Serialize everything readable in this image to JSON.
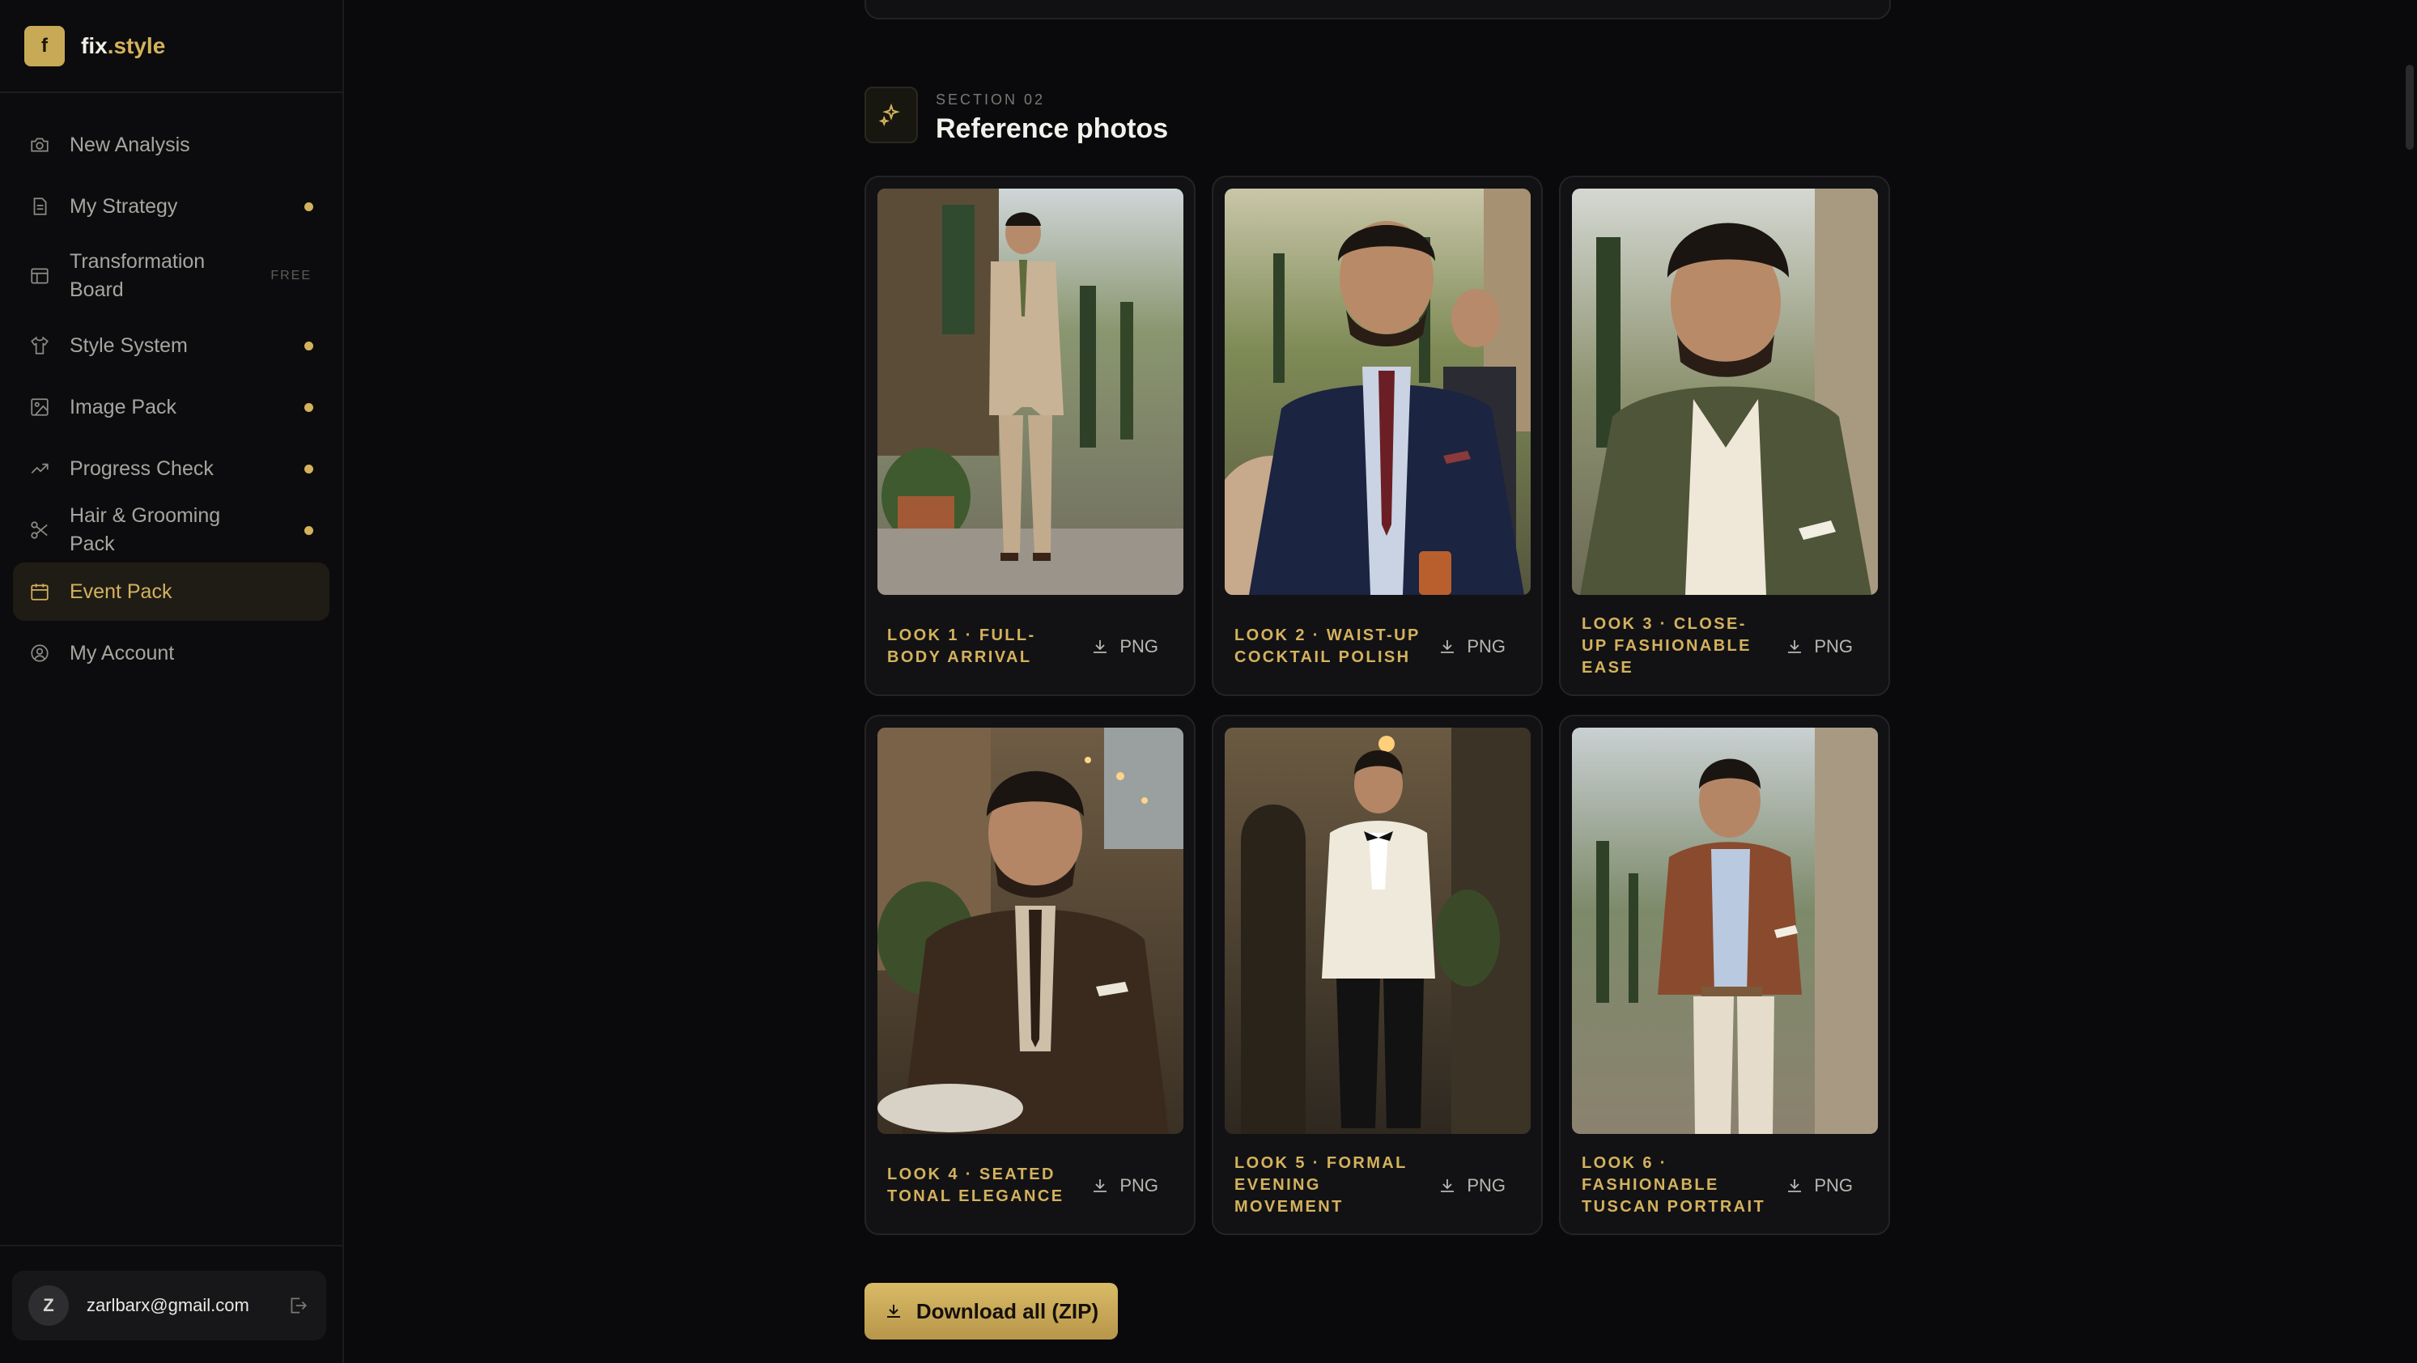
{
  "app": {
    "brand_initial": "f",
    "brand_name_main": "fix",
    "brand_name_accent": ".style"
  },
  "sidebar": {
    "items": [
      {
        "label": "New Analysis",
        "icon": "camera-icon",
        "badge": ""
      },
      {
        "label": "My Strategy",
        "icon": "document-icon",
        "badge": "dot"
      },
      {
        "label": "Transformation Board",
        "icon": "layout-icon",
        "badge": "FREE"
      },
      {
        "label": "Style System",
        "icon": "shirt-icon",
        "badge": "dot"
      },
      {
        "label": "Image Pack",
        "icon": "image-icon",
        "badge": "dot"
      },
      {
        "label": "Progress Check",
        "icon": "trend-icon",
        "badge": "dot"
      },
      {
        "label": "Hair & Grooming Pack",
        "icon": "scissors-icon",
        "badge": "dot"
      },
      {
        "label": "Event Pack",
        "icon": "calendar-icon",
        "badge": "",
        "active": true
      },
      {
        "label": "My Account",
        "icon": "user-circle-icon",
        "badge": ""
      }
    ],
    "free_label": "FREE",
    "user": {
      "initial": "Z",
      "email": "zarlbarx@gmail.com"
    }
  },
  "section": {
    "kicker": "SECTION 02",
    "title": "Reference photos"
  },
  "looks": [
    {
      "caption": "LOOK 1 · FULL-BODY ARRIVAL",
      "action": "PNG",
      "suit": "#c9b396",
      "tie": "#5f6b3b",
      "shirt": "#e8e4da",
      "bg": "#6f7a4f"
    },
    {
      "caption": "LOOK 2 · WAIST-UP COCKTAIL POLISH",
      "action": "PNG",
      "suit": "#1b2440",
      "tie": "#6b1f24",
      "shirt": "#c9d3e4",
      "bg": "#7f8a5a"
    },
    {
      "caption": "LOOK 3 · CLOSE-UP FASHIONABLE EASE",
      "action": "PNG",
      "suit": "#4f5538",
      "tie": "#efe8d8",
      "shirt": "#efe8d8",
      "bg": "#8a8a6a"
    },
    {
      "caption": "LOOK 4 · SEATED TONAL ELEGANCE",
      "action": "PNG",
      "suit": "#3a2a1e",
      "tie": "#2b1e15",
      "shirt": "#cdbfa8",
      "bg": "#4a3e30"
    },
    {
      "caption": "LOOK 5 · FORMAL EVENING MOVEMENT",
      "action": "PNG",
      "suit": "#efe9dc",
      "tie": "#111111",
      "shirt": "#ffffff",
      "bg": "#3b3326"
    },
    {
      "caption": "LOOK 6 · FASHIONABLE TUSCAN PORTRAIT",
      "action": "PNG",
      "suit": "#8a4a2e",
      "tie": "#b9c9e0",
      "shirt": "#b9c9e0",
      "bg": "#7d8a6a"
    }
  ],
  "download_all": "Download all (ZIP)",
  "colors": {
    "accent": "#d4b25c",
    "background": "#0a0a0c",
    "card": "#121215"
  }
}
